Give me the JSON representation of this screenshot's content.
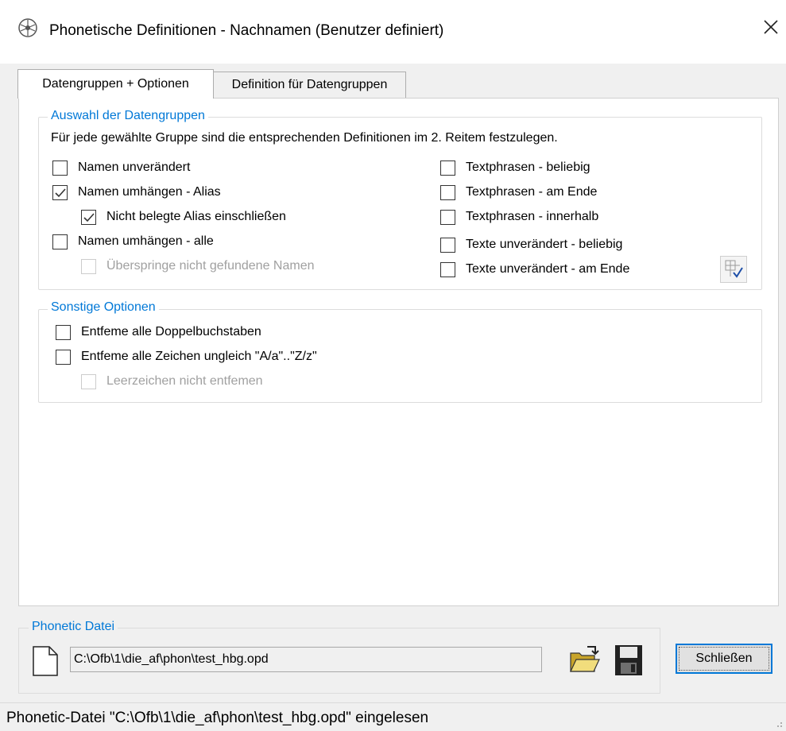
{
  "window": {
    "title": "Phonetische Definitionen - Nachnamen (Benutzer definiert)",
    "app_icon": "tree-icon",
    "close_icon": "close-icon"
  },
  "tabs": [
    {
      "label": "Datengruppen + Optionen",
      "active": true
    },
    {
      "label": "Definition für Datengruppen",
      "active": false
    }
  ],
  "datagroups": {
    "legend": "Auswahl der Datengruppen",
    "note": "Für jede gewählte Gruppe sind die entsprechenden Definitionen im 2. Reitem festzulegen.",
    "left": [
      {
        "label": "Namen unverändert",
        "checked": false,
        "enabled": true
      },
      {
        "label": "Namen umhängen - Alias",
        "checked": true,
        "enabled": true
      },
      {
        "label": "Nicht belegte Alias einschließen",
        "checked": true,
        "enabled": true
      },
      {
        "label": "Namen umhängen - alle",
        "checked": false,
        "enabled": true
      },
      {
        "label": "Überspringe nicht gefundene Namen",
        "checked": false,
        "enabled": false
      }
    ],
    "right": [
      {
        "label": "Textphrasen - beliebig",
        "checked": false
      },
      {
        "label": "Textphrasen - am Ende",
        "checked": false
      },
      {
        "label": "Textphrasen - innerhalb",
        "checked": false
      },
      {
        "label": "Texte unverändert - beliebig",
        "checked": false
      },
      {
        "label": "Texte unverändert - am Ende",
        "checked": false
      }
    ],
    "select_button_icon": "select-all-icon"
  },
  "options": {
    "legend": "Sonstige Optionen",
    "items": [
      {
        "label": "Entfeme alle Doppelbuchstaben",
        "checked": false,
        "enabled": true
      },
      {
        "label": "Entfeme alle Zeichen ungleich \"A/a\"..\"Z/z\"",
        "checked": false,
        "enabled": true
      },
      {
        "label": "Leerzeichen nicht entfemen",
        "checked": false,
        "enabled": false
      }
    ]
  },
  "phonetic_file": {
    "legend": "Phonetic Datei",
    "path": "C:\\Ofb\\1\\die_af\\phon\\test_hbg.opd",
    "new_icon": "new-document-icon",
    "open_icon": "open-folder-icon",
    "save_icon": "save-icon"
  },
  "close_button": "Schließen",
  "status": "Phonetic-Datei \"C:\\Ofb\\1\\die_af\\phon\\test_hbg.opd\" eingelesen",
  "colors": {
    "accent": "#0078d7",
    "window_bg": "#f0f0f0",
    "panel_bg": "#ffffff"
  }
}
